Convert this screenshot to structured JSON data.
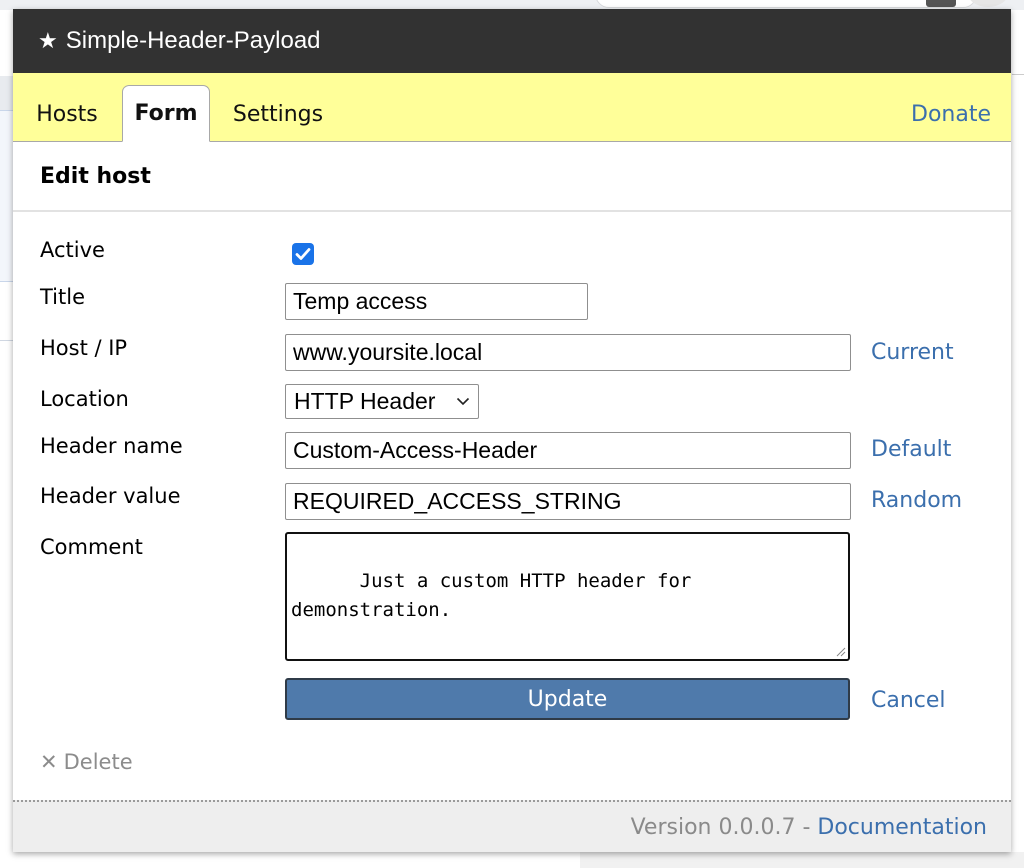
{
  "app": {
    "title": "Simple-Header-Payload",
    "title_icon": "star-icon",
    "star_glyph": "★"
  },
  "tabs": [
    {
      "label": "Hosts",
      "active": false
    },
    {
      "label": "Form",
      "active": true
    },
    {
      "label": "Settings",
      "active": false
    }
  ],
  "donate_label": "Donate",
  "section": {
    "title": "Edit host"
  },
  "form": {
    "active": {
      "label": "Active",
      "checked": true
    },
    "title": {
      "label": "Title",
      "value": "Temp access"
    },
    "host": {
      "label": "Host / IP",
      "value": "www.yoursite.local",
      "action": "Current"
    },
    "location": {
      "label": "Location",
      "value": "HTTP Header"
    },
    "header_name": {
      "label": "Header name",
      "value": "Custom-Access-Header",
      "action": "Default"
    },
    "header_value": {
      "label": "Header value",
      "value": "REQUIRED_ACCESS_STRING",
      "action": "Random"
    },
    "comment": {
      "label": "Comment",
      "value": "Just a custom HTTP header for\ndemonstration."
    },
    "update_label": "Update",
    "cancel_label": "Cancel",
    "delete_label": "Delete",
    "delete_glyph": "✕"
  },
  "footer": {
    "version_text": "Version 0.0.0.7 - ",
    "doc_label": "Documentation"
  },
  "colors": {
    "titlebar": "#323232",
    "tabbar": "#ffff99",
    "link": "#3b6fad",
    "button": "#4f7aab",
    "checkbox": "#1a73e8",
    "footer": "#eeeeee"
  }
}
